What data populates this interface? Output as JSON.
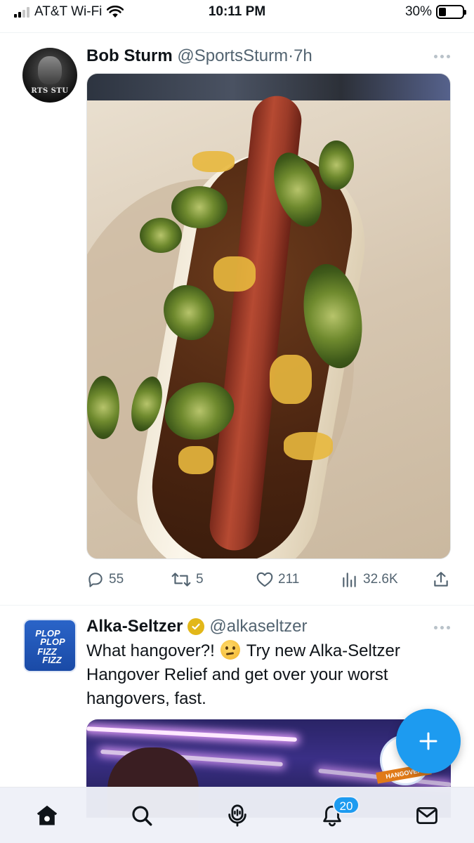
{
  "status_bar": {
    "carrier": "AT&T Wi-Fi",
    "time": "10:11 PM",
    "battery_percent": "30%",
    "battery_level": 0.3,
    "signal_bars_active": 2
  },
  "tweets": [
    {
      "author_name": "Bob Sturm",
      "handle": "@SportsSturm",
      "separator": "·",
      "time_ago": "7h",
      "avatar_text": "RTS STU",
      "media_subject": "hot-dog-with-chili-cheese-jalapenos",
      "actions": {
        "replies": "55",
        "reposts": "5",
        "likes": "211",
        "views": "32.6K"
      }
    },
    {
      "author_name": "Alka-Seltzer",
      "handle": "@alkaseltzer",
      "verified": true,
      "verified_color": "#e2b719",
      "text_part1": "What hangover?!",
      "emoji_name": "thinking-face",
      "text_part2": "Try new Alka-Seltzer Hangover Relief and get over your worst hangovers, fast.",
      "avatar_lines": [
        "PLOP",
        "PLOP",
        "FIZZ",
        "FIZZ"
      ],
      "media_badge_text": "HANGOVER"
    }
  ],
  "fab": {
    "icon": "plus-icon",
    "color": "#1d9bf0"
  },
  "bottom_nav": {
    "items": [
      "home-icon",
      "search-icon",
      "spaces-icon",
      "notifications-icon",
      "messages-icon"
    ],
    "notifications_badge": "20"
  },
  "colors": {
    "accent": "#1d9bf0",
    "secondary_text": "#536471",
    "primary_text": "#0f1419"
  }
}
